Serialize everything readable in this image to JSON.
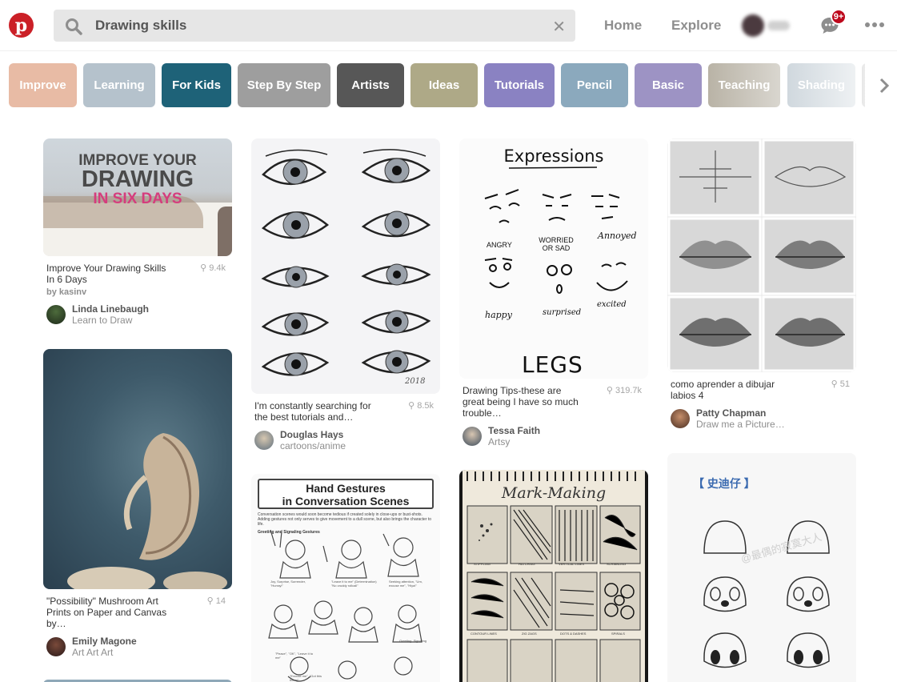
{
  "header": {
    "search_value": "Drawing skills",
    "clear_icon": "close-icon",
    "nav": [
      "Home",
      "Explore"
    ],
    "notification_badge": "9+"
  },
  "guides": [
    {
      "label": "Improve",
      "color": "#e8bba5"
    },
    {
      "label": "Learning",
      "color": "#b5c2cc"
    },
    {
      "label": "For Kids",
      "color": "#1e6278"
    },
    {
      "label": "Step By Step",
      "color": "#9e9e9e"
    },
    {
      "label": "Artists",
      "color": "#575757"
    },
    {
      "label": "Ideas",
      "color": "#aea987"
    },
    {
      "label": "Tutorials",
      "color": "#8a82c2"
    },
    {
      "label": "Pencil",
      "color": "#8ba9bd"
    },
    {
      "label": "Basic",
      "color": "#9d93c4"
    },
    {
      "label": "Teaching",
      "color": "#c5c0b5"
    },
    {
      "label": "Shading",
      "color": "#d5dbe0"
    }
  ],
  "pins": [
    {
      "image_text": [
        "IMPROVE YOUR",
        "DRAWING",
        "IN SIX DAYS"
      ],
      "description": "Improve Your Drawing Skills In 6 Days",
      "saves": "9.4k",
      "by": "by kasinv",
      "user": "Linda Linebaugh",
      "board": "Learn to Draw"
    },
    {
      "description": "\"Possibility\" Mushroom Art Prints on Paper and Canvas by…",
      "saves": "14",
      "user": "Emily Magone",
      "board": "Art Art Art"
    },
    {
      "image_text": [
        "2018"
      ],
      "description": "I'm constantly searching for the best tutorials and…",
      "saves": "8.5k",
      "user": "Douglas Hays",
      "board": "cartoons/anime"
    },
    {
      "image_text": [
        "Hand Gestures",
        "in Conversation Scenes",
        "Conversation scenes would soon become tedious if created solely in close-ups or bust-shots. Adding gestures not only serves to give movement to a dull scene, but also brings the character to life.",
        "Greeting and Signaling Gestures",
        "Joy, Surprise, Surrender, \"Hurray!\"",
        "\"Leave it to me\" (Determination) \"No cruddy rollcall\"",
        "Seeking attention, \"Um, excuse me\", \"Hiya!\"",
        "\"Peace\", \"OK\", \"Leave it to me\"",
        "Greeting, Signaling",
        "\"Excuse me\", \"Got this there!\""
      ]
    },
    {
      "image_text": [
        "Expressions",
        "ANGRY",
        "WORRIED OR SAD",
        "Annoyed",
        "happy",
        "surprised",
        "excited",
        "LEGS"
      ],
      "description": "Drawing Tips-these are great being I have so much trouble…",
      "saves": "319.7k",
      "user": "Tessa Faith",
      "board": "Artsy"
    },
    {
      "image_text": [
        "Mark-Making",
        "STIPPLING",
        "HATCHING",
        "VERTICAL LINES",
        "SCRIBBLING",
        "CONTOUR LINES",
        "ZIG ZAGS",
        "DOTS & DASHES",
        "SPIRALS"
      ]
    },
    {
      "description": "como aprender a dibujar labios 4",
      "saves": "51",
      "user": "Patty Chapman",
      "board": "Draw me a Picture…"
    },
    {
      "image_text": [
        "【 史迪仔 】",
        "@最偶的寂寞大人"
      ]
    }
  ]
}
